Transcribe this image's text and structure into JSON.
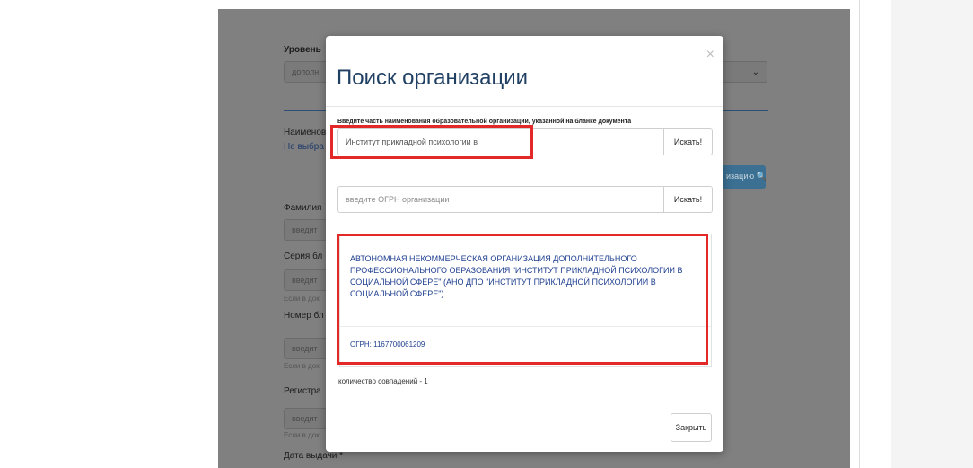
{
  "background_form": {
    "level_label": "Уровень",
    "level_value": "дополн",
    "name_label": "Наименов",
    "not_selected": "Не выбра",
    "search_org_button": "изацию",
    "lastname_label": "Фамилия",
    "lastname_placeholder": "введит",
    "series_label": "Серия бл",
    "series_placeholder": "введит",
    "hint_1": "Если в док",
    "number_label": "Номер бл",
    "number_placeholder": "введит",
    "hint_2": "Если в док",
    "reg_label": "Регистра",
    "reg_placeholder": "введит",
    "hint_3": "Если в док",
    "issue_date_label": "Дата выдачи *"
  },
  "modal": {
    "title": "Поиск организации",
    "close_glyph": "×",
    "field_label": "Введите часть наименования образовательной организации, указанной на бланке документа",
    "name_input_value": "Институт прикладной психологии в",
    "search_button_label": "Искать!",
    "ogrn_input_placeholder": "введите ОГРН организации",
    "ogrn_search_button_label": "Искать!",
    "result_text": "АВТОНОМНАЯ НЕКОММЕРЧЕСКАЯ ОРГАНИЗАЦИЯ ДОПОЛНИТЕЛЬНОГО ПРОФЕССИОНАЛЬНОГО ОБРАЗОВАНИЯ \"ИНСТИТУТ ПРИКЛАДНОЙ ПСИХОЛОГИИ В СОЦИАЛЬНОЙ СФЕРЕ\" (АНО ДПО \"ИНСТИТУТ ПРИКЛАДНОЙ ПСИХОЛОГИИ В СОЦИАЛЬНОЙ СФЕРЕ\")",
    "ogrn_text": "ОГРН: 1167700061209",
    "match_count": "количество совпадений - 1",
    "close_button_label": "Закрыть"
  },
  "colors": {
    "highlight": "#e32828",
    "title": "#1f3f63",
    "result_text": "#1f3f8f",
    "overlay": "#808080"
  }
}
